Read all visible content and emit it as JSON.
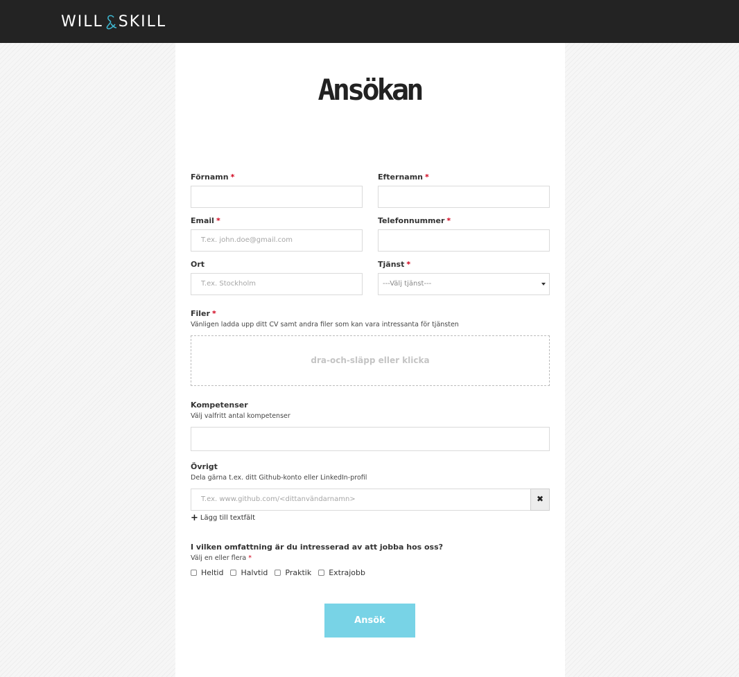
{
  "header": {
    "brand_left": "WILL",
    "brand_right": "SKILL"
  },
  "page": {
    "title": "Ansökan"
  },
  "form": {
    "first_name": {
      "label": "Förnamn",
      "required": "*",
      "value": ""
    },
    "last_name": {
      "label": "Efternamn",
      "required": "*",
      "value": ""
    },
    "email": {
      "label": "Email",
      "required": "*",
      "placeholder": "T.ex. john.doe@gmail.com"
    },
    "phone": {
      "label": "Telefonnummer",
      "required": "*",
      "value": ""
    },
    "city": {
      "label": "Ort",
      "placeholder": "T.ex. Stockholm"
    },
    "service": {
      "label": "Tjänst",
      "required": "*",
      "selected": "---Välj tjänst---"
    },
    "files": {
      "label": "Filer",
      "required": "*",
      "hint": "Vänligen ladda upp ditt CV samt andra filer som kan vara intressanta för tjänsten",
      "dropzone_text": "dra-och-släpp eller klicka"
    },
    "skills": {
      "label": "Kompetenser",
      "hint": "Välj valfritt antal kompetenser",
      "value": ""
    },
    "other": {
      "label": "Övrigt",
      "hint": "Dela gärna t.ex. ditt Github-konto eller LinkedIn-profil",
      "placeholder": "T.ex. www.github.com/<dittanvändarnamn>",
      "clear_symbol": "✖",
      "add_field_label": "Lägg till textfält"
    },
    "scope": {
      "question": "I vilken omfattning är du intresserad av att jobba hos oss?",
      "hint": "Välj en eller flera",
      "required": "*",
      "options": [
        "Heltid",
        "Halvtid",
        "Praktik",
        "Extrajobb"
      ]
    },
    "submit_label": "Ansök"
  },
  "colors": {
    "topbar": "#232323",
    "accent": "#78d3e6",
    "required": "#d0021b",
    "logo_ampersand": "#3fb6cf"
  }
}
